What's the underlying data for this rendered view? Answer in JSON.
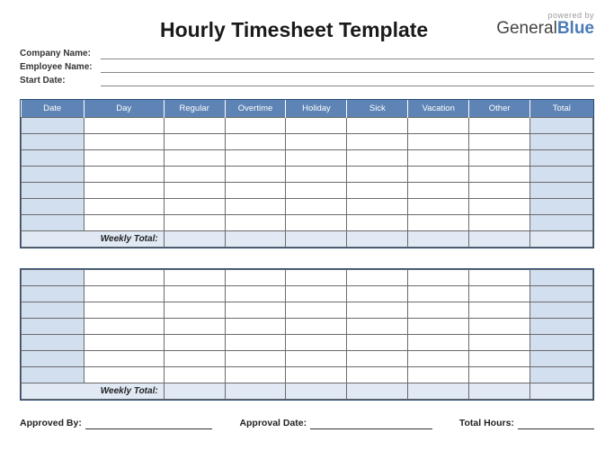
{
  "title": "Hourly Timesheet Template",
  "brand": {
    "powered_by": "powered by",
    "name_part1": "General",
    "name_part2": "Blue"
  },
  "meta": {
    "company_label": "Company Name:",
    "company_value": "",
    "employee_label": "Employee Name:",
    "employee_value": "",
    "startdate_label": "Start Date:",
    "startdate_value": ""
  },
  "columns": {
    "date": "Date",
    "day": "Day",
    "regular": "Regular",
    "overtime": "Overtime",
    "holiday": "Holiday",
    "sick": "Sick",
    "vacation": "Vacation",
    "other": "Other",
    "total": "Total"
  },
  "weekly_total_label": "Weekly Total:",
  "week1_rows": [
    {
      "date": "",
      "day": "",
      "regular": "",
      "overtime": "",
      "holiday": "",
      "sick": "",
      "vacation": "",
      "other": "",
      "total": ""
    },
    {
      "date": "",
      "day": "",
      "regular": "",
      "overtime": "",
      "holiday": "",
      "sick": "",
      "vacation": "",
      "other": "",
      "total": ""
    },
    {
      "date": "",
      "day": "",
      "regular": "",
      "overtime": "",
      "holiday": "",
      "sick": "",
      "vacation": "",
      "other": "",
      "total": ""
    },
    {
      "date": "",
      "day": "",
      "regular": "",
      "overtime": "",
      "holiday": "",
      "sick": "",
      "vacation": "",
      "other": "",
      "total": ""
    },
    {
      "date": "",
      "day": "",
      "regular": "",
      "overtime": "",
      "holiday": "",
      "sick": "",
      "vacation": "",
      "other": "",
      "total": ""
    },
    {
      "date": "",
      "day": "",
      "regular": "",
      "overtime": "",
      "holiday": "",
      "sick": "",
      "vacation": "",
      "other": "",
      "total": ""
    },
    {
      "date": "",
      "day": "",
      "regular": "",
      "overtime": "",
      "holiday": "",
      "sick": "",
      "vacation": "",
      "other": "",
      "total": ""
    }
  ],
  "week2_rows": [
    {
      "date": "",
      "day": "",
      "regular": "",
      "overtime": "",
      "holiday": "",
      "sick": "",
      "vacation": "",
      "other": "",
      "total": ""
    },
    {
      "date": "",
      "day": "",
      "regular": "",
      "overtime": "",
      "holiday": "",
      "sick": "",
      "vacation": "",
      "other": "",
      "total": ""
    },
    {
      "date": "",
      "day": "",
      "regular": "",
      "overtime": "",
      "holiday": "",
      "sick": "",
      "vacation": "",
      "other": "",
      "total": ""
    },
    {
      "date": "",
      "day": "",
      "regular": "",
      "overtime": "",
      "holiday": "",
      "sick": "",
      "vacation": "",
      "other": "",
      "total": ""
    },
    {
      "date": "",
      "day": "",
      "regular": "",
      "overtime": "",
      "holiday": "",
      "sick": "",
      "vacation": "",
      "other": "",
      "total": ""
    },
    {
      "date": "",
      "day": "",
      "regular": "",
      "overtime": "",
      "holiday": "",
      "sick": "",
      "vacation": "",
      "other": "",
      "total": ""
    },
    {
      "date": "",
      "day": "",
      "regular": "",
      "overtime": "",
      "holiday": "",
      "sick": "",
      "vacation": "",
      "other": "",
      "total": ""
    }
  ],
  "footer": {
    "approved_by_label": "Approved By:",
    "approved_by_value": "",
    "approval_date_label": "Approval Date:",
    "approval_date_value": "",
    "total_hours_label": "Total Hours:",
    "total_hours_value": ""
  }
}
